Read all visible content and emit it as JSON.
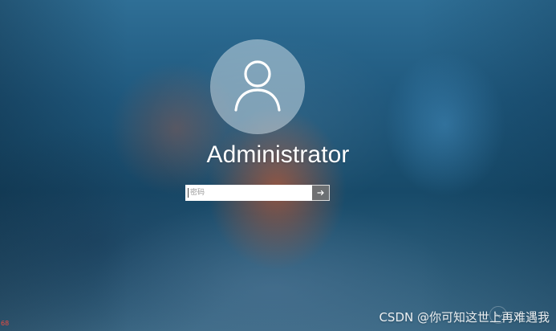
{
  "user": {
    "name": "Administrator"
  },
  "login": {
    "password_placeholder": "密码",
    "submit_icon": "arrow-right-icon"
  },
  "overlay": {
    "bottom_left_mark": "68",
    "watermark": "CSDN @你可知这世上再难遇我"
  },
  "icons": {
    "avatar": "user-icon"
  },
  "colors": {
    "text": "#ffffff",
    "accent_watermark_red": "#ff4c3d",
    "input_background": "#ffffff",
    "submit_background": "#787878"
  }
}
